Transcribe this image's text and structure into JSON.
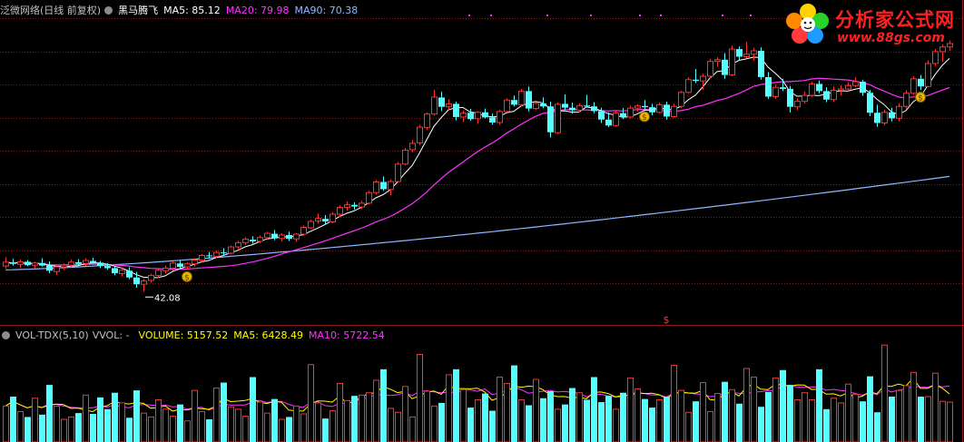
{
  "price_header": {
    "title": "泛微网络(日线 前复权)",
    "indicator_name": "黑马腾飞",
    "ma5_text": "MA5: 85.12",
    "ma20_text": "MA20: 79.98",
    "ma90_text": "MA90: 70.38"
  },
  "volume_header": {
    "indicator": "VOL-TDX(5,10)",
    "vvol": "VVOL: -",
    "volume_text": "VOLUME: 5157.52",
    "ma5_text": "MA5: 6428.49",
    "ma10_text": "MA10: 5722.54"
  },
  "logo": {
    "title": "分析家公式网",
    "url": "www.88gs.com"
  },
  "colors": {
    "up": "#ff3232",
    "down": "#54ffff",
    "ma5": "#ffffff",
    "ma20": "#ff32ff",
    "ma90": "#8fb8ff",
    "vol_ma5": "#ffff00",
    "vol_ma10": "#ff32ff",
    "header_text": "#c0c0c0",
    "header_white": "#ffffff",
    "header_yellow": "#ffff00",
    "header_magenta": "#ff32ff",
    "header_blue": "#8fb8ff",
    "grid": "#8a1a1a",
    "signal": "#ff3232",
    "icon_money": "money-bag-icon"
  },
  "chart_data": [
    {
      "type": "candlestick",
      "title": "泛微网络(日线 前复权)",
      "ylim": [
        38.5,
        100.5
      ],
      "low_label": "42.08",
      "signal_marker": "$",
      "grid": true,
      "series": [
        {
          "name": "MA5",
          "last": 85.12
        },
        {
          "name": "MA20",
          "last": 79.98
        },
        {
          "name": "MA90",
          "last": 70.38
        }
      ],
      "candles": [
        [
          48.1,
          50.2,
          47.5,
          49.0
        ],
        [
          48.9,
          49.8,
          48.2,
          48.6
        ],
        [
          48.5,
          49.6,
          47.7,
          49.1
        ],
        [
          49.1,
          49.5,
          48.1,
          48.3
        ],
        [
          48.3,
          49.1,
          47.6,
          48.8
        ],
        [
          48.8,
          49.9,
          48.0,
          48.2
        ],
        [
          48.2,
          49.2,
          46.4,
          47.0
        ],
        [
          46.8,
          48.4,
          46.0,
          47.9
        ],
        [
          47.9,
          48.7,
          47.2,
          48.3
        ],
        [
          48.3,
          49.6,
          47.8,
          49.0
        ],
        [
          49.0,
          49.7,
          48.2,
          48.6
        ],
        [
          48.7,
          49.9,
          48.1,
          49.4
        ],
        [
          49.3,
          50.0,
          48.6,
          48.9
        ],
        [
          48.9,
          49.3,
          47.6,
          48.1
        ],
        [
          48.1,
          48.8,
          47.2,
          47.6
        ],
        [
          47.6,
          48.0,
          45.9,
          46.4
        ],
        [
          46.3,
          47.6,
          45.6,
          47.1
        ],
        [
          47.0,
          47.8,
          45.0,
          45.4
        ],
        [
          45.4,
          46.7,
          43.0,
          43.8
        ],
        [
          43.8,
          45.1,
          42.08,
          44.6
        ],
        [
          44.7,
          46.3,
          44.2,
          45.9
        ],
        [
          45.9,
          47.5,
          45.3,
          47.1
        ],
        [
          47.0,
          48.2,
          46.3,
          47.6
        ],
        [
          47.6,
          49.2,
          47.0,
          48.8
        ],
        [
          48.7,
          49.4,
          47.4,
          47.9
        ],
        [
          47.9,
          49.0,
          47.3,
          48.6
        ],
        [
          48.6,
          49.9,
          48.0,
          49.5
        ],
        [
          49.5,
          50.9,
          49.0,
          50.6
        ],
        [
          50.6,
          51.4,
          49.8,
          50.4
        ],
        [
          50.4,
          51.7,
          50.0,
          51.3
        ],
        [
          51.3,
          52.3,
          50.5,
          51.1
        ],
        [
          51.1,
          52.9,
          50.8,
          52.6
        ],
        [
          52.6,
          54.0,
          52.1,
          53.6
        ],
        [
          53.6,
          54.9,
          53.1,
          54.4
        ],
        [
          54.3,
          55.1,
          53.4,
          53.9
        ],
        [
          53.9,
          55.3,
          53.5,
          54.8
        ],
        [
          54.8,
          56.2,
          54.3,
          55.8
        ],
        [
          55.7,
          56.6,
          54.2,
          54.6
        ],
        [
          54.6,
          55.8,
          53.9,
          55.4
        ],
        [
          55.4,
          56.2,
          54.0,
          54.5
        ],
        [
          54.5,
          55.9,
          53.8,
          55.6
        ],
        [
          55.6,
          57.6,
          55.2,
          57.2
        ],
        [
          57.1,
          59.0,
          56.8,
          58.6
        ],
        [
          58.7,
          60.5,
          58.1,
          59.3
        ],
        [
          59.2,
          60.1,
          58.0,
          58.6
        ],
        [
          58.5,
          60.8,
          58.2,
          60.3
        ],
        [
          60.3,
          62.4,
          59.7,
          61.9
        ],
        [
          61.9,
          63.3,
          61.2,
          62.5
        ],
        [
          62.5,
          63.1,
          61.4,
          62.1
        ],
        [
          62.0,
          63.5,
          61.5,
          62.9
        ],
        [
          62.9,
          65.8,
          62.6,
          65.4
        ],
        [
          65.4,
          68.3,
          64.9,
          67.9
        ],
        [
          67.9,
          69.2,
          65.8,
          66.2
        ],
        [
          66.1,
          68.5,
          64.8,
          68.0
        ],
        [
          68.0,
          72.6,
          67.7,
          72.1
        ],
        [
          72.1,
          75.9,
          71.8,
          75.4
        ],
        [
          75.5,
          77.8,
          74.9,
          77.0
        ],
        [
          77.1,
          81.4,
          76.6,
          80.8
        ],
        [
          80.7,
          84.3,
          80.2,
          83.9
        ],
        [
          83.9,
          89.6,
          83.5,
          87.9
        ],
        [
          87.8,
          89.2,
          84.6,
          85.6
        ],
        [
          85.6,
          87.4,
          84.9,
          86.3
        ],
        [
          86.3,
          86.8,
          82.4,
          83.2
        ],
        [
          83.2,
          84.7,
          82.0,
          84.1
        ],
        [
          84.2,
          85.1,
          82.3,
          82.7
        ],
        [
          82.8,
          84.6,
          81.6,
          84.3
        ],
        [
          84.3,
          85.2,
          82.9,
          83.1
        ],
        [
          83.1,
          84.0,
          81.4,
          81.9
        ],
        [
          81.9,
          84.9,
          81.4,
          84.5
        ],
        [
          84.5,
          87.6,
          84.2,
          87.2
        ],
        [
          87.2,
          88.3,
          85.7,
          86.1
        ],
        [
          86.1,
          89.8,
          85.7,
          89.3
        ],
        [
          89.3,
          90.4,
          84.5,
          85.2
        ],
        [
          85.2,
          86.7,
          84.9,
          86.4
        ],
        [
          86.4,
          87.8,
          85.3,
          85.7
        ],
        [
          85.7,
          86.8,
          78.4,
          79.6
        ],
        [
          79.5,
          86.6,
          79.2,
          86.2
        ],
        [
          86.3,
          88.5,
          84.9,
          85.4
        ],
        [
          85.4,
          86.6,
          84.0,
          84.8
        ],
        [
          84.8,
          86.4,
          84.3,
          85.9
        ],
        [
          85.9,
          88.4,
          85.4,
          85.7
        ],
        [
          85.7,
          86.7,
          84.1,
          84.6
        ],
        [
          84.6,
          85.4,
          81.8,
          82.6
        ],
        [
          82.6,
          84.3,
          80.8,
          81.2
        ],
        [
          81.2,
          84.6,
          80.9,
          84.1
        ],
        [
          84.1,
          85.3,
          82.7,
          83.2
        ],
        [
          83.2,
          85.9,
          82.9,
          85.3
        ],
        [
          85.3,
          86.2,
          84.5,
          85.8
        ],
        [
          85.8,
          87.2,
          85.0,
          85.5
        ],
        [
          85.5,
          86.3,
          83.6,
          84.3
        ],
        [
          84.3,
          86.6,
          84.0,
          86.1
        ],
        [
          86.1,
          86.8,
          82.6,
          83.3
        ],
        [
          83.3,
          86.3,
          83.0,
          85.7
        ],
        [
          85.7,
          89.4,
          85.3,
          89.0
        ],
        [
          89.0,
          92.6,
          88.7,
          92.0
        ],
        [
          92.0,
          94.5,
          91.2,
          91.7
        ],
        [
          91.7,
          93.4,
          89.6,
          92.8
        ],
        [
          92.8,
          96.9,
          92.3,
          96.3
        ],
        [
          96.3,
          97.3,
          95.0,
          96.7
        ],
        [
          96.7,
          98.2,
          92.2,
          93.1
        ],
        [
          93.1,
          100.0,
          92.8,
          99.2
        ],
        [
          99.2,
          99.8,
          96.6,
          97.4
        ],
        [
          97.4,
          100.9,
          97.0,
          98.0
        ],
        [
          98.0,
          99.5,
          96.4,
          98.8
        ],
        [
          98.8,
          99.6,
          92.0,
          92.6
        ],
        [
          92.6,
          93.8,
          87.5,
          88.0
        ],
        [
          88.0,
          90.8,
          87.4,
          90.2
        ],
        [
          90.2,
          92.2,
          89.3,
          89.8
        ],
        [
          89.8,
          90.5,
          84.3,
          85.6
        ],
        [
          85.6,
          87.6,
          84.9,
          86.9
        ],
        [
          86.9,
          89.2,
          86.4,
          88.3
        ],
        [
          88.3,
          91.5,
          87.9,
          91.0
        ],
        [
          91.0,
          91.8,
          88.8,
          89.3
        ],
        [
          89.3,
          90.2,
          86.7,
          87.3
        ],
        [
          87.3,
          90.4,
          86.7,
          89.5
        ],
        [
          89.5,
          90.7,
          88.3,
          89.8
        ],
        [
          89.8,
          91.4,
          89.3,
          90.6
        ],
        [
          90.6,
          92.6,
          90.2,
          91.5
        ],
        [
          91.5,
          91.9,
          88.2,
          88.9
        ],
        [
          88.9,
          89.6,
          83.4,
          84.2
        ],
        [
          84.2,
          86.1,
          80.9,
          81.8
        ],
        [
          81.8,
          84.9,
          81.3,
          84.3
        ],
        [
          84.3,
          85.4,
          82.2,
          82.9
        ],
        [
          82.9,
          86.4,
          82.2,
          85.7
        ],
        [
          85.7,
          89.5,
          85.2,
          88.8
        ],
        [
          88.8,
          92.8,
          88.4,
          92.2
        ],
        [
          92.2,
          93.1,
          89.6,
          90.4
        ],
        [
          90.4,
          96.5,
          90.2,
          95.8
        ],
        [
          95.8,
          99.2,
          95.2,
          98.6
        ],
        [
          98.6,
          100.3,
          96.2,
          99.7
        ],
        [
          99.7,
          101.2,
          98.8,
          100.5
        ]
      ]
    },
    {
      "type": "bar",
      "title": "VOL-TDX(5,10)",
      "ylim": [
        0,
        13000
      ],
      "series": [
        {
          "name": "VOLUME",
          "last": 5157.52
        },
        {
          "name": "MA5",
          "last": 6428.49
        },
        {
          "name": "MA10",
          "last": 5722.54
        }
      ],
      "values": [
        4600,
        5800,
        3900,
        3200,
        5600,
        3500,
        7300,
        4600,
        2900,
        3200,
        3700,
        6000,
        3600,
        5700,
        4200,
        6300,
        5000,
        3100,
        6600,
        3700,
        3200,
        5400,
        4200,
        3300,
        4800,
        2700,
        6600,
        3900,
        2900,
        6900,
        7600,
        4500,
        4200,
        3300,
        8300,
        5100,
        3700,
        5500,
        2900,
        3200,
        4600,
        3600,
        9900,
        5000,
        3000,
        4000,
        7500,
        5300,
        5900,
        6000,
        6300,
        7900,
        9300,
        4300,
        3800,
        7100,
        3200,
        11200,
        6500,
        4600,
        5000,
        8600,
        9300,
        6700,
        4400,
        5400,
        6200,
        4000,
        8300,
        7500,
        9800,
        5400,
        4700,
        8000,
        5600,
        6500,
        4200,
        4800,
        6900,
        6300,
        5400,
        8300,
        5100,
        5900,
        4200,
        6300,
        8200,
        6800,
        5500,
        4400,
        5400,
        5800,
        9800,
        6600,
        3800,
        5200,
        7600,
        3900,
        6200,
        7700,
        6700,
        4900,
        9400,
        8300,
        4500,
        6400,
        8200,
        9200,
        7300,
        5400,
        6300,
        5400,
        9300,
        4200,
        5600,
        5000,
        7400,
        6100,
        5200,
        8400,
        3800,
        12400,
        5800,
        6600,
        7200,
        8900,
        5800,
        5800,
        8800,
        5200,
        5100
      ]
    }
  ]
}
